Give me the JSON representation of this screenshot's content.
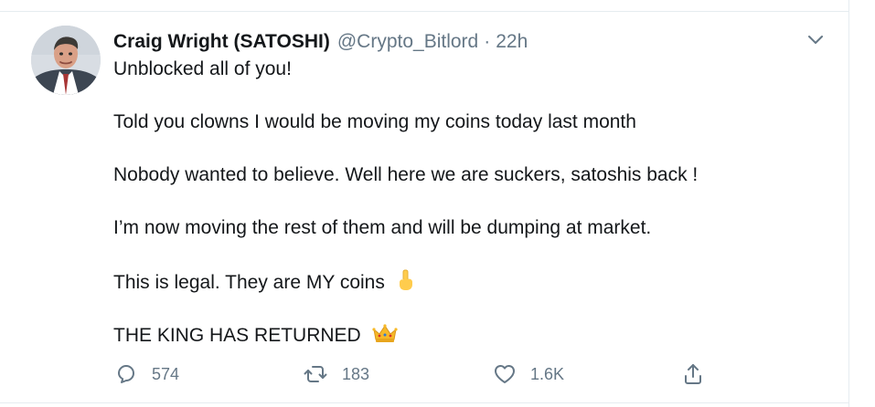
{
  "tweet": {
    "author_name": "Craig Wright (SATOSHI)",
    "handle": "@Crypto_Bitlord",
    "separator": "·",
    "time": "22h",
    "lines": [
      "Unblocked all of you!",
      "Told you clowns I would be moving my coins today last month",
      "Nobody wanted to believe. Well here we are suckers, satoshis back !",
      "I’m now moving the rest of them and will be dumping at market.",
      "This is legal. They are MY coins",
      "THE KING HAS RETURNED"
    ],
    "line_emojis": {
      "line5": "middle-finger-emoji",
      "line6": "crown-emoji"
    }
  },
  "actions": {
    "reply_count": "574",
    "retweet_count": "183",
    "like_count": "1.6K"
  },
  "icons": {
    "avatar": "avatar",
    "menu": "chevron-down-icon",
    "reply": "reply-icon",
    "retweet": "retweet-icon",
    "like": "heart-icon",
    "share": "share-icon"
  },
  "colors": {
    "text": "#14171a",
    "muted": "#657786",
    "divider": "#e6ecf0",
    "accent": "#1da1f2"
  }
}
